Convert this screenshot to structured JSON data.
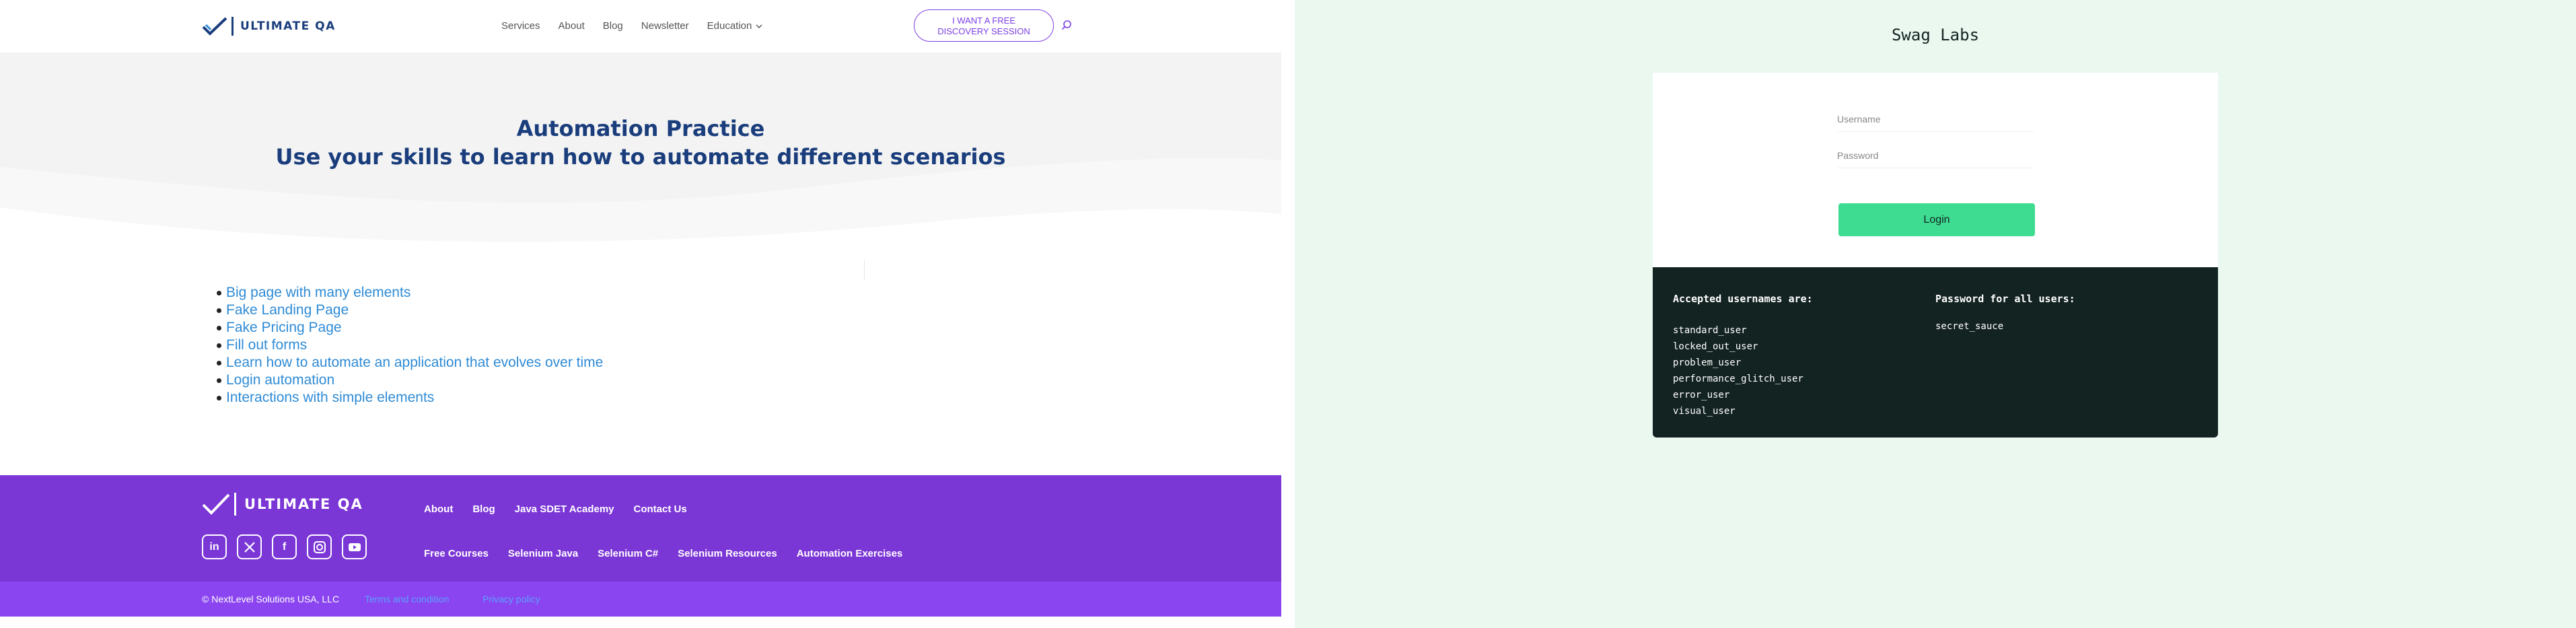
{
  "ultimateqa": {
    "logo_text": "ULTIMATE QA",
    "nav": [
      "Services",
      "About",
      "Blog",
      "Newsletter",
      "Education"
    ],
    "cta_line1": "I WANT A FREE",
    "cta_line2": "DISCOVERY SESSION",
    "hero": {
      "title": "Automation Practice",
      "subtitle": "Use your skills to learn how to automate different scenarios"
    },
    "links": [
      "Big page with many elements",
      "Fake Landing Page",
      "Fake Pricing Page",
      "Fill out forms",
      "Learn how to automate an application that evolves over time",
      "Login automation",
      "Interactions with simple elements"
    ],
    "footer": {
      "logo_text": "ULTIMATE QA",
      "row1": [
        "About",
        "Blog",
        "Java SDET Academy",
        "Contact Us"
      ],
      "row2": [
        "Free Courses",
        "Selenium Java",
        "Selenium C#",
        "Selenium Resources",
        "Automation Exercises"
      ],
      "social": [
        "linkedin-icon",
        "x-icon",
        "facebook-icon",
        "instagram-icon",
        "youtube-icon"
      ],
      "copyright": "© NextLevel Solutions USA, LLC",
      "terms": "Terms and condition",
      "privacy": "Privacy policy"
    },
    "colors": {
      "brand_navy": "#1a3d7c",
      "accent_purple": "#7b3fe4",
      "link_blue": "#2e8bd6",
      "footer_purple": "#7b36d6"
    }
  },
  "swaglabs": {
    "title": "Swag Labs",
    "username_placeholder": "Username",
    "password_placeholder": "Password",
    "login_label": "Login",
    "accepted_heading": "Accepted usernames are:",
    "usernames": [
      "standard_user",
      "locked_out_user",
      "problem_user",
      "performance_glitch_user",
      "error_user",
      "visual_user"
    ],
    "password_heading": "Password for all users:",
    "password": "secret_sauce",
    "colors": {
      "bg": "#eaf8f0",
      "button": "#3ddc91",
      "panel": "#132322"
    }
  }
}
